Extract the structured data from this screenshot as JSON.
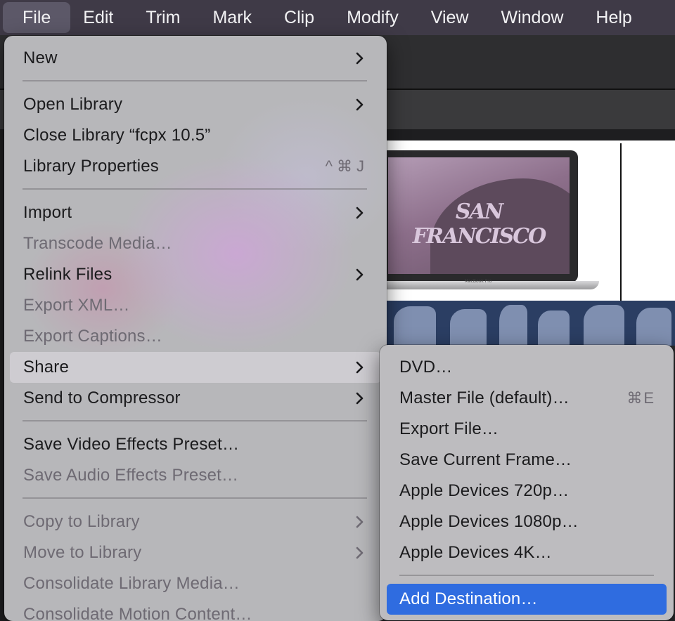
{
  "menubar": {
    "items": [
      "File",
      "Edit",
      "Trim",
      "Mark",
      "Clip",
      "Modify",
      "View",
      "Window",
      "Help"
    ],
    "active": "File"
  },
  "file_menu": {
    "new": "New",
    "open_library": "Open Library",
    "close_library": "Close Library “fcpx 10.5”",
    "library_properties": "Library Properties",
    "library_properties_shortcut": "^⌘J",
    "import": "Import",
    "transcode_media": "Transcode Media…",
    "relink_files": "Relink Files",
    "export_xml": "Export XML…",
    "export_captions": "Export Captions…",
    "share": "Share",
    "send_to_compressor": "Send to Compressor",
    "save_video_effects_preset": "Save Video Effects Preset…",
    "save_audio_effects_preset": "Save Audio Effects Preset…",
    "copy_to_library": "Copy to Library",
    "move_to_library": "Move to Library",
    "consolidate_library_media": "Consolidate Library Media…",
    "consolidate_motion_content": "Consolidate Motion Content…"
  },
  "share_submenu": {
    "dvd": "DVD…",
    "master_file": "Master File (default)…",
    "master_file_shortcut": "⌘E",
    "export_file": "Export File…",
    "save_current_frame": "Save Current Frame…",
    "apple_devices_720p": "Apple Devices 720p…",
    "apple_devices_1080p": "Apple Devices 1080p…",
    "apple_devices_4k": "Apple Devices 4K…",
    "add_destination": "Add Destination…"
  },
  "viewer": {
    "overlay_text": "SAN FRANCISCO",
    "laptop_brand": "MacBook Pro"
  },
  "colors": {
    "menu_highlight": "#d2d0d5",
    "selected_item": "#2f6ce0",
    "menubar_bg": "#3f3a47"
  }
}
